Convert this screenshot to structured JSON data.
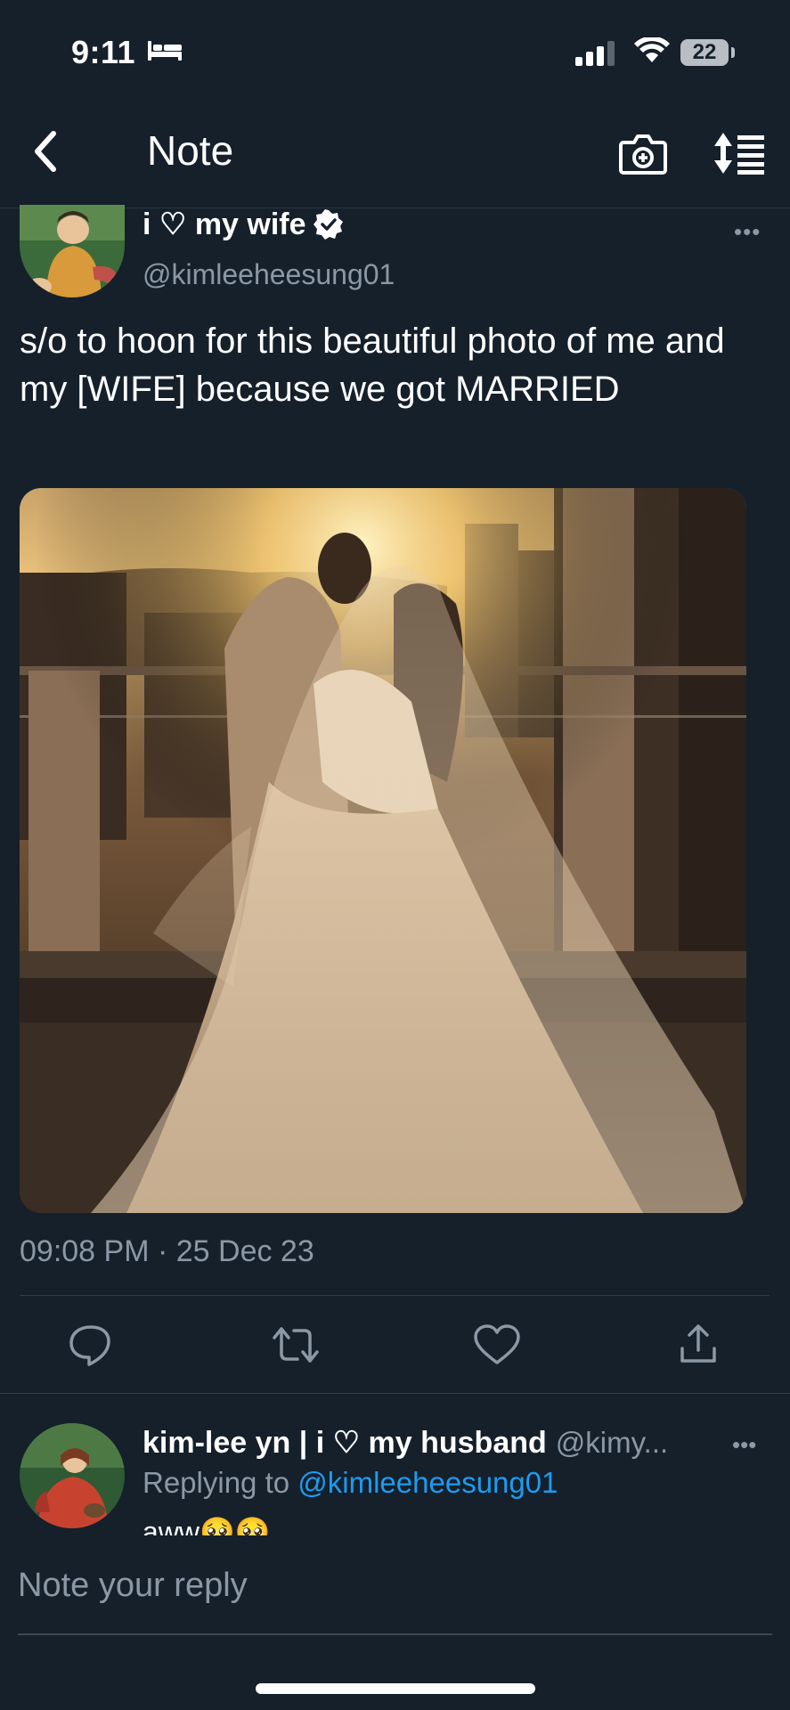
{
  "status_bar": {
    "time": "9:11",
    "battery": "22"
  },
  "header": {
    "title": "Note"
  },
  "tweet": {
    "author_name": "i ♡ my wife",
    "handle": "@kimleeheesung01",
    "text": "s/o to hoon for this beautiful photo of me and my [WIFE] because we got MARRIED",
    "timestamp": "09:08 PM · 25 Dec 23"
  },
  "reply": {
    "author_name": "kim-lee yn | i ♡ my husband",
    "handle": "@kimy...",
    "replying_prefix": "Replying to",
    "replying_to": "@kimleeheesung01",
    "text": "aww🥺🥺"
  },
  "compose": {
    "placeholder": "Note your reply"
  },
  "icons": {
    "back": "chevron-left-icon",
    "camera": "camera-plus-icon",
    "sort": "sort-icon",
    "reply": "comment-icon",
    "retweet": "retweet-icon",
    "like": "heart-icon",
    "share": "share-icon",
    "more": "more-icon",
    "verified": "verified-badge-icon"
  },
  "colors": {
    "background": "#15202b",
    "accent": "#1d9bf0",
    "muted": "#8b98a5"
  }
}
